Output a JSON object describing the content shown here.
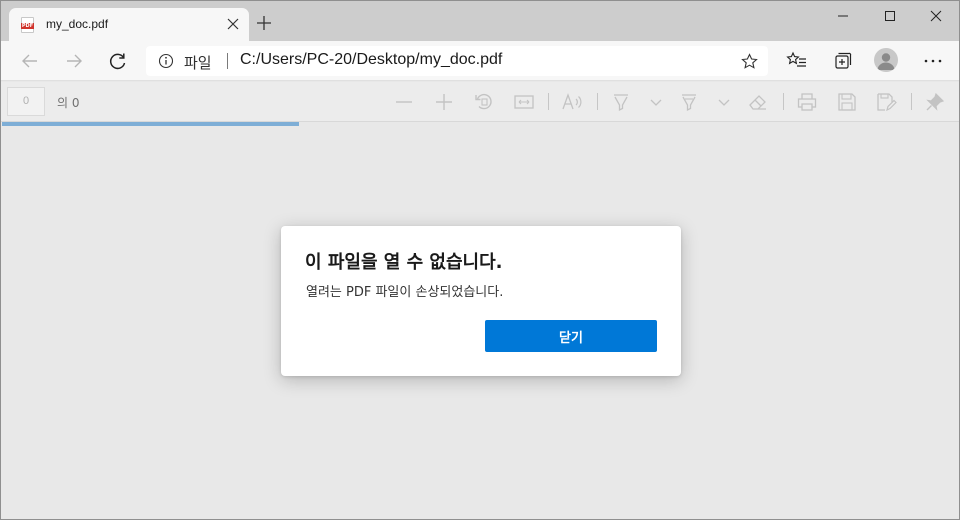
{
  "tab": {
    "favicon_text": "PDF",
    "title": "my_doc.pdf"
  },
  "window_controls": [
    "minimize-icon",
    "maximize-icon",
    "close-icon"
  ],
  "address": {
    "info_label": "파일",
    "url": "C:/Users/PC-20/Desktop/my_doc.pdf"
  },
  "pdf_toolbar": {
    "page_number": "0",
    "page_count": "의 0",
    "tools": [
      "zoom-out-icon",
      "zoom-in-icon",
      "rotate-icon",
      "fit-page-icon",
      "read-aloud-icon",
      "draw-icon",
      "highlight-icon",
      "erase-icon",
      "print-icon",
      "save-icon",
      "save-as-icon",
      "pin-icon"
    ]
  },
  "progress": {
    "fraction": 0.31
  },
  "dialog": {
    "title": "이 파일을 열 수 없습니다.",
    "message": "열려는 PDF 파일이 손상되었습니다.",
    "close_button": "닫기"
  },
  "colors": {
    "accent": "#0078d7",
    "tabstrip": "#cdcdcd",
    "page_background": "#e8e8e8",
    "progress": "#7eaed6"
  }
}
